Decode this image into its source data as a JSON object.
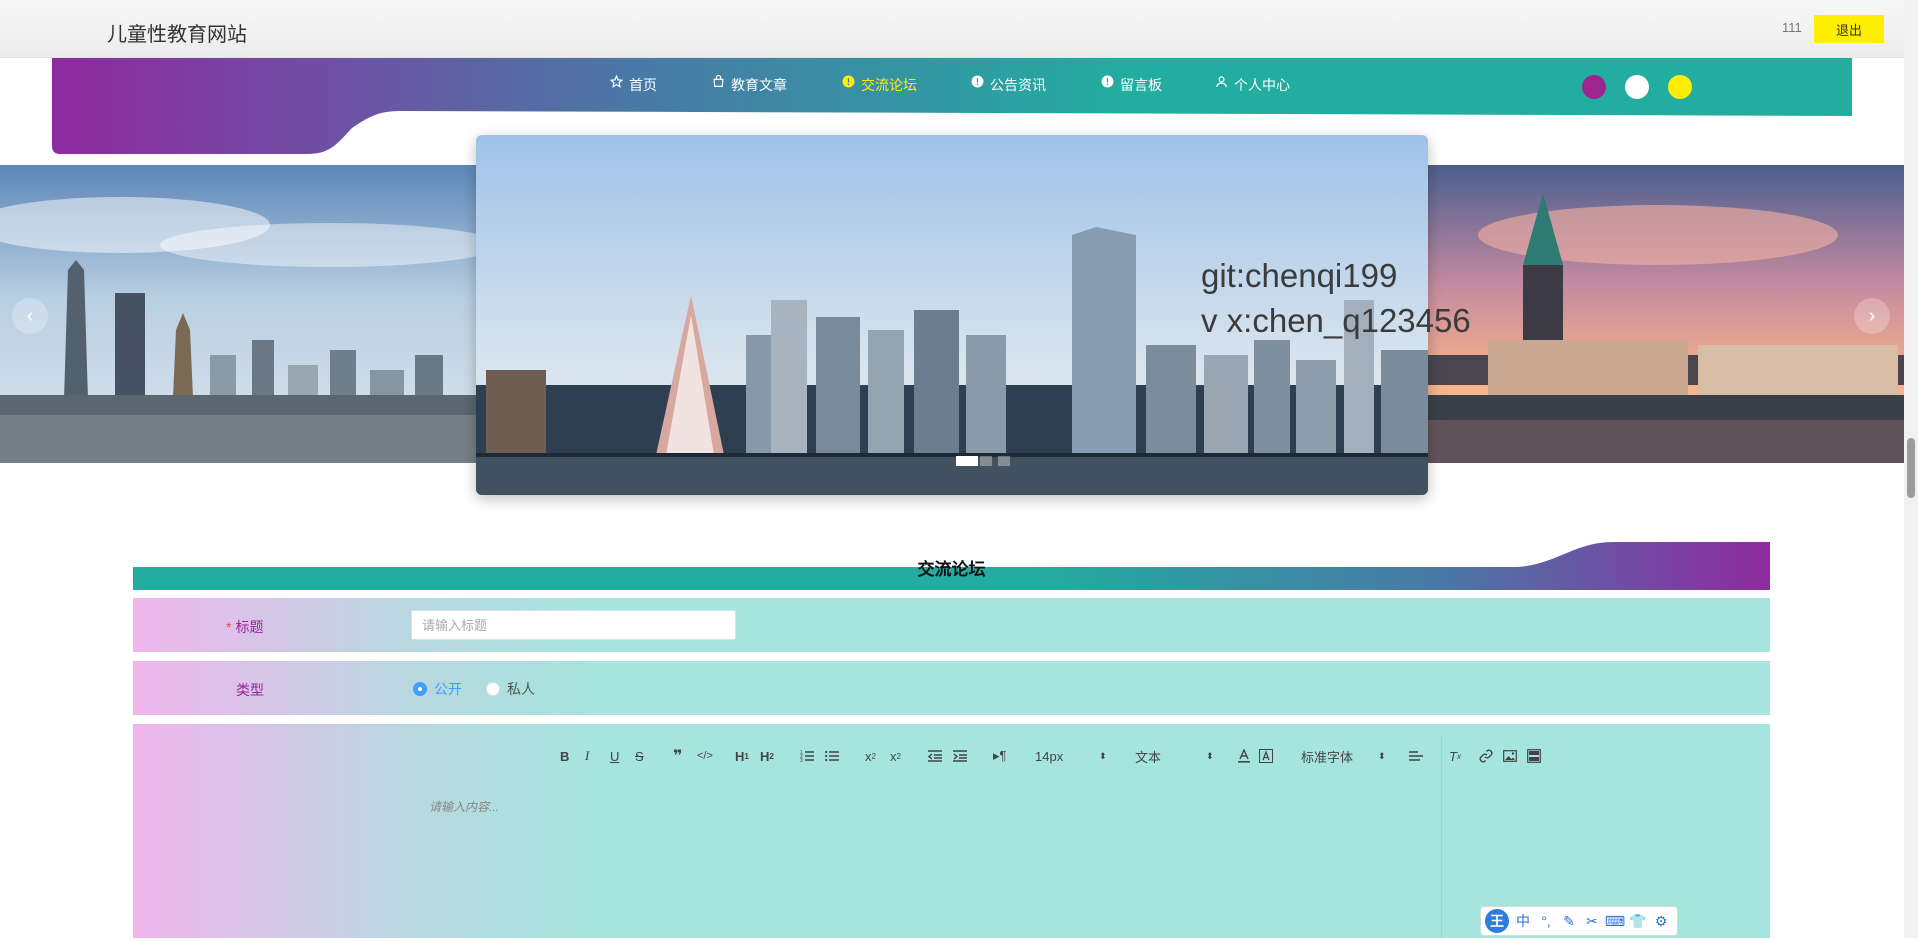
{
  "header": {
    "site_title": "儿童性教育网站",
    "username": "111",
    "logout_label": "退出"
  },
  "nav": {
    "items": [
      {
        "label": "首页",
        "icon": "star-icon",
        "active": false
      },
      {
        "label": "教育文章",
        "icon": "bag-icon",
        "active": false
      },
      {
        "label": "交流论坛",
        "icon": "info-circle-icon",
        "active": true
      },
      {
        "label": "公告资讯",
        "icon": "info-circle-icon",
        "active": false
      },
      {
        "label": "留言板",
        "icon": "info-circle-icon",
        "active": false
      },
      {
        "label": "个人中心",
        "icon": "user-icon",
        "active": false
      }
    ],
    "theme_colors": [
      "#9c2590",
      "#ffffff",
      "#ffee00"
    ],
    "active_color": "#ffee00",
    "gradient_start": "#8f2aa0",
    "gradient_end": "#22ada0"
  },
  "carousel": {
    "watermark_lines": [
      "git:chenqi199",
      "v x:chen_q123456"
    ],
    "prev_icon": "chevron-left-icon",
    "next_icon": "chevron-right-icon",
    "slide_count": 3,
    "active_index": 0
  },
  "forum": {
    "section_title": "交流论坛",
    "title_field": {
      "label": "标题",
      "required_mark": "*",
      "placeholder": "请输入标题",
      "value": ""
    },
    "type_field": {
      "label": "类型",
      "options": [
        {
          "label": "公开",
          "selected": true
        },
        {
          "label": "私人",
          "selected": false
        }
      ]
    },
    "content_field": {
      "placeholder": "请输入内容...",
      "font_size": "14px",
      "block_format": "文本",
      "font_family": "标准字体"
    }
  },
  "ime_toolbar": {
    "logo": "王",
    "items": [
      "中",
      "°,"
    ]
  }
}
